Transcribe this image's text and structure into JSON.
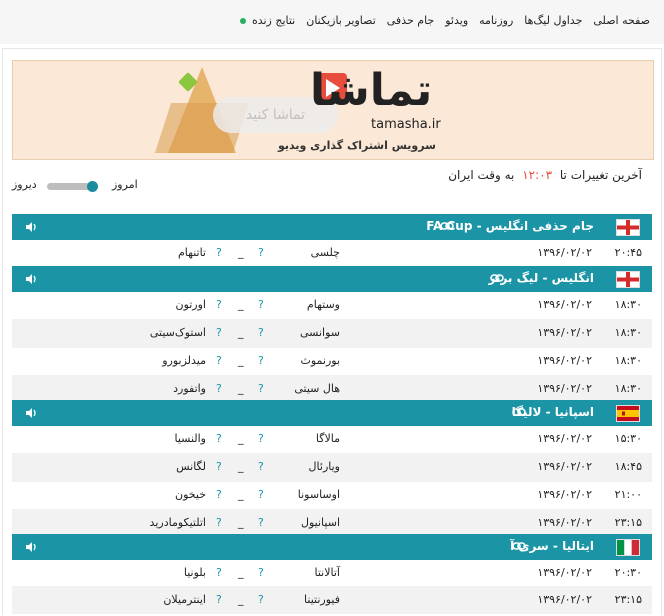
{
  "nav": {
    "items": [
      "صفحه اصلی",
      "جداول لیگ‌ها",
      "روزنامه",
      "ویدئو",
      "جام حذفی",
      "تصاویر بازیکنان",
      "نتایج زنده"
    ]
  },
  "banner": {
    "logo_word": "تماشا",
    "logo_latin": "tamasha.ir",
    "watch_text": "تماشا کنید",
    "tagline": "سرویس اشتراک گذاری ویدیو"
  },
  "status": {
    "prefix": "آخرین تغییرات تا",
    "time": "۱۲:۰۳",
    "suffix": "به وقت ایران"
  },
  "day_toggle": {
    "left": "دیروز",
    "right": "امروز"
  },
  "colors": {
    "accent": "#1b95a6",
    "time_red": "#e74c3c",
    "live_dot": "#27ae60"
  },
  "leagues": [
    {
      "name": "جام حذفی انگلیس - FA Cup",
      "flag": "england",
      "matches": [
        {
          "time": "۲۰:۴۵",
          "date": "۱۳۹۶/۰۲/۰۲",
          "home": "چلسی",
          "home_score": "?",
          "sep": "_",
          "away_score": "?",
          "away": "تاتنهام"
        }
      ]
    },
    {
      "name": "انگلیس - لیگ برتر",
      "flag": "england",
      "matches": [
        {
          "time": "۱۸:۳۰",
          "date": "۱۳۹۶/۰۲/۰۲",
          "home": "وستهام",
          "home_score": "?",
          "sep": "_",
          "away_score": "?",
          "away": "اورتون"
        },
        {
          "time": "۱۸:۳۰",
          "date": "۱۳۹۶/۰۲/۰۲",
          "home": "سوانسی",
          "home_score": "?",
          "sep": "_",
          "away_score": "?",
          "away": "استوک‌سیتی"
        },
        {
          "time": "۱۸:۳۰",
          "date": "۱۳۹۶/۰۲/۰۲",
          "home": "بورنموث",
          "home_score": "?",
          "sep": "_",
          "away_score": "?",
          "away": "میدلزبورو"
        },
        {
          "time": "۱۸:۳۰",
          "date": "۱۳۹۶/۰۲/۰۲",
          "home": "هال سیتی",
          "home_score": "?",
          "sep": "_",
          "away_score": "?",
          "away": "واتفورد"
        }
      ]
    },
    {
      "name": "اسپانیا - لالیگا",
      "flag": "spain",
      "matches": [
        {
          "time": "۱۵:۳۰",
          "date": "۱۳۹۶/۰۲/۰۲",
          "home": "مالاگا",
          "home_score": "?",
          "sep": "_",
          "away_score": "?",
          "away": "والنسیا"
        },
        {
          "time": "۱۸:۴۵",
          "date": "۱۳۹۶/۰۲/۰۲",
          "home": "ویارئال",
          "home_score": "?",
          "sep": "_",
          "away_score": "?",
          "away": "لگانس"
        },
        {
          "time": "۲۱:۰۰",
          "date": "۱۳۹۶/۰۲/۰۲",
          "home": "اوساسونا",
          "home_score": "?",
          "sep": "_",
          "away_score": "?",
          "away": "خیخون"
        },
        {
          "time": "۲۳:۱۵",
          "date": "۱۳۹۶/۰۲/۰۲",
          "home": "اسپانیول",
          "home_score": "?",
          "sep": "_",
          "away_score": "?",
          "away": "اتلتیکومادرید"
        }
      ]
    },
    {
      "name": "ایتالیا - سری آ",
      "flag": "italy",
      "matches": [
        {
          "time": "۲۰:۳۰",
          "date": "۱۳۹۶/۰۲/۰۲",
          "home": "آتالانتا",
          "home_score": "?",
          "sep": "_",
          "away_score": "?",
          "away": "بلونیا"
        },
        {
          "time": "۲۳:۱۵",
          "date": "۱۳۹۶/۰۲/۰۲",
          "home": "فیورنتینا",
          "home_score": "?",
          "sep": "_",
          "away_score": "?",
          "away": "اینترمیلان"
        }
      ]
    }
  ]
}
